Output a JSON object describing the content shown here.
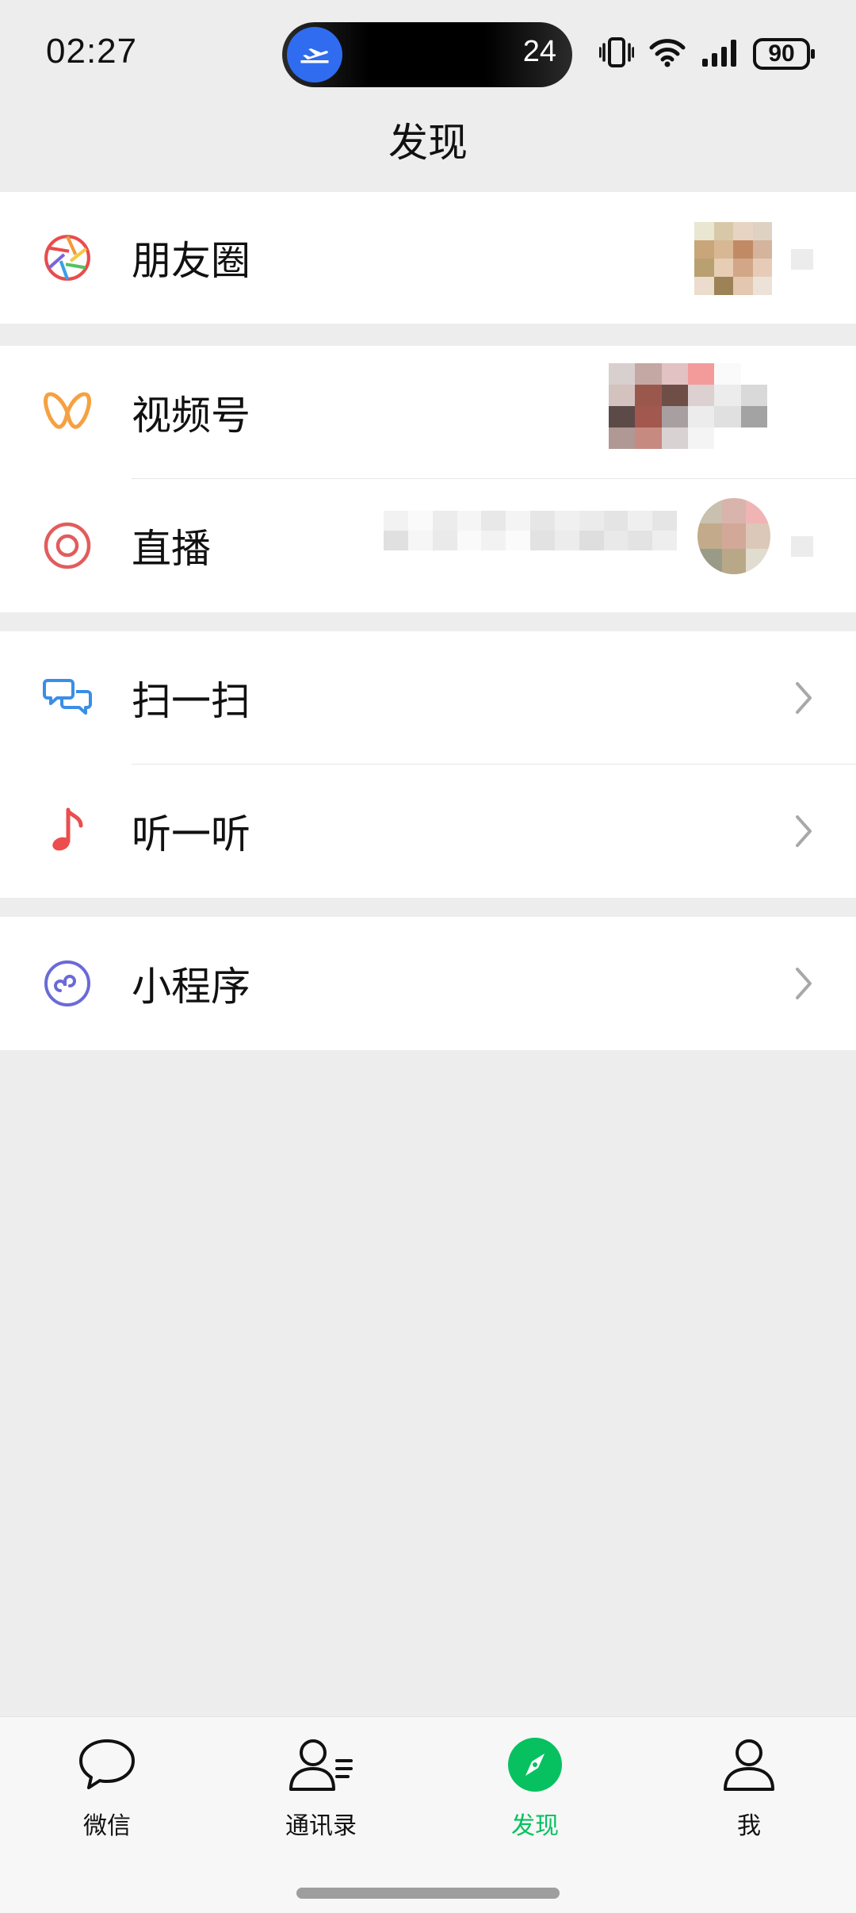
{
  "status_bar": {
    "time": "02:27",
    "island_count": "24",
    "battery": "90"
  },
  "header": {
    "title": "发现"
  },
  "menu": {
    "moments": "朋友圈",
    "channels": "视频号",
    "live": "直播",
    "scan": "扫一扫",
    "listen": "听一听",
    "mini_programs": "小程序"
  },
  "tabbar": {
    "tabs": [
      {
        "label": "微信",
        "active": false
      },
      {
        "label": "通讯录",
        "active": false
      },
      {
        "label": "发现",
        "active": true
      },
      {
        "label": "我",
        "active": false
      }
    ]
  },
  "colors": {
    "accent": "#07c160",
    "channels": "#f5a142",
    "live": "#e25c5c",
    "scan": "#3a8ee6",
    "listen": "#ec4d4d",
    "mini": "#6a6ad8"
  },
  "icons": {
    "moments": "aperture-icon",
    "channels": "butterfly-icon",
    "live": "live-ring-icon",
    "scan": "scan-icon",
    "listen": "music-note-icon",
    "mini": "mini-program-icon"
  }
}
